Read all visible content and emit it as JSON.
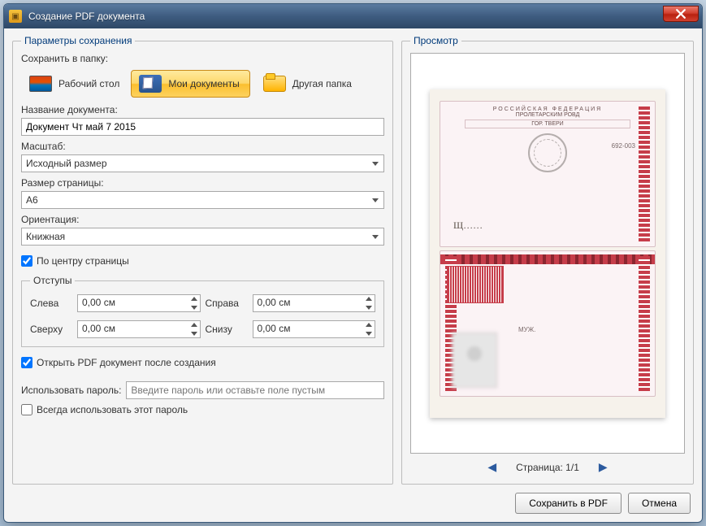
{
  "window": {
    "title": "Создание PDF документа"
  },
  "params": {
    "legend": "Параметры сохранения",
    "saveToFolderLabel": "Сохранить в папку:",
    "folders": {
      "desktop": "Рабочий стол",
      "myDocs": "Мои документы",
      "other": "Другая папка"
    },
    "docNameLabel": "Название документа:",
    "docName": "Документ Чт май 7 2015",
    "scaleLabel": "Масштаб:",
    "scaleValue": "Исходный размер",
    "pageSizeLabel": "Размер страницы:",
    "pageSizeValue": "A6",
    "orientationLabel": "Ориентация:",
    "orientationValue": "Книжная",
    "centerPage": "По центру страницы",
    "marginsLegend": "Отступы",
    "margins": {
      "leftLabel": "Слева",
      "left": "0,00 см",
      "rightLabel": "Справа",
      "right": "0,00 см",
      "topLabel": "Сверху",
      "top": "0,00 см",
      "bottomLabel": "Снизу",
      "bottom": "0,00 см"
    },
    "openAfter": "Открыть PDF документ после создания",
    "passwordLabel": "Использовать пароль:",
    "passwordPlaceholder": "Введите пароль или оставьте поле пустым",
    "alwaysPassword": "Всегда использовать этот пароль"
  },
  "preview": {
    "legend": "Просмотр",
    "pagerLabel": "Страница: 1/1",
    "doc": {
      "country": "РОССИЙСКАЯ ФЕДЕРАЦИЯ",
      "dept": "ПРОЛЕТАРСКИМ РОВД",
      "city": "ГОР. ТВЕРИ",
      "code": "692-003",
      "sex": "МУЖ."
    }
  },
  "footer": {
    "save": "Сохранить в PDF",
    "cancel": "Отмена"
  }
}
